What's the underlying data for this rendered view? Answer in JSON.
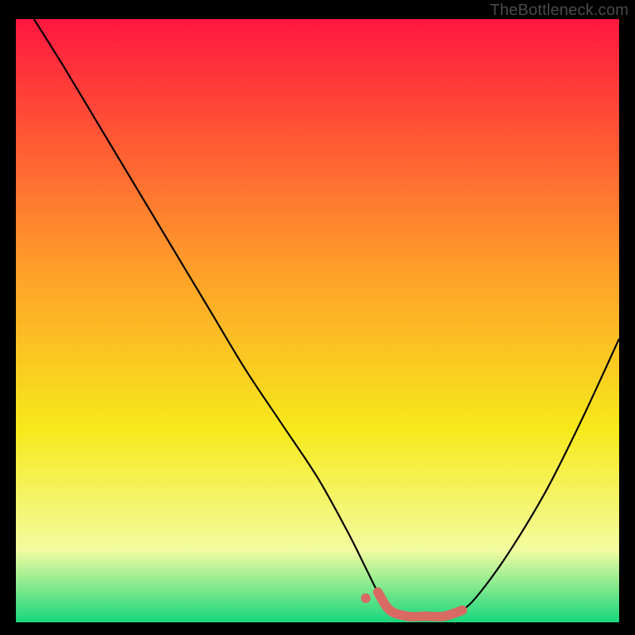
{
  "watermark": "TheBottleneck.com",
  "colors": {
    "frame": "#000000",
    "gradient_top": "#ff173f",
    "gradient_mid1": "#ff9a2a",
    "gradient_mid2": "#f7e91b",
    "gradient_low": "#f3fca0",
    "gradient_bottom": "#17d67d",
    "curve": "#000000",
    "marker_fill": "#d86a63",
    "marker_stroke": "#d86a63"
  },
  "chart_data": {
    "type": "line",
    "title": "",
    "xlabel": "",
    "ylabel": "",
    "xlim": [
      0,
      100
    ],
    "ylim": [
      0,
      100
    ],
    "grid": false,
    "legend": false,
    "series": [
      {
        "name": "bottleneck-curve",
        "x": [
          3,
          8,
          14,
          20,
          26,
          32,
          38,
          44,
          50,
          55,
          58,
          60,
          62,
          65,
          68,
          71,
          74,
          77,
          82,
          88,
          94,
          100
        ],
        "y": [
          100,
          92,
          82,
          72,
          62,
          52,
          42,
          33,
          24,
          15,
          9,
          5,
          2,
          1,
          1,
          1,
          2,
          5,
          12,
          22,
          34,
          47
        ]
      }
    ],
    "annotations": [
      {
        "type": "point",
        "x": 58,
        "y": 4,
        "label": "start-marker"
      },
      {
        "type": "segment",
        "x0": 60,
        "y0": 2,
        "x1": 74,
        "y1": 2,
        "label": "optimal-range"
      }
    ],
    "background_gradient": {
      "direction": "vertical",
      "stops": [
        {
          "pos": 0.0,
          "color": "#ff173f"
        },
        {
          "pos": 0.4,
          "color": "#ff9a2a"
        },
        {
          "pos": 0.68,
          "color": "#f7e91b"
        },
        {
          "pos": 0.88,
          "color": "#f3fca0"
        },
        {
          "pos": 1.0,
          "color": "#17d67d"
        }
      ]
    }
  }
}
